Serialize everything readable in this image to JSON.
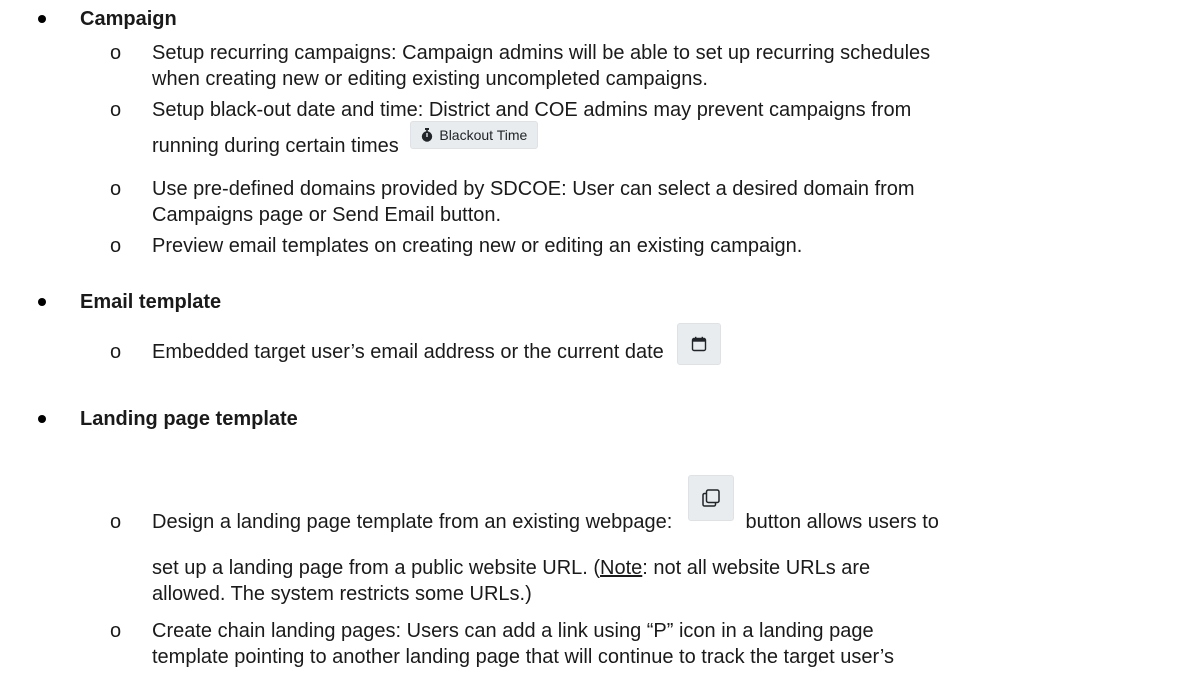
{
  "sections": {
    "campaign": {
      "heading": "Campaign",
      "items": [
        {
          "bullet": "o",
          "line1": "Setup recurring campaigns: Campaign admins will be able to set up recurring schedules",
          "line2": "when creating new or editing existing uncompleted campaigns."
        },
        {
          "bullet": "o",
          "line1": "Setup black-out date and time: District and COE admins may prevent campaigns from",
          "line2": "running during certain times",
          "button_label": "Blackout Time",
          "button_icon": "stopwatch-icon"
        },
        {
          "bullet": "o",
          "line1": "Use pre-defined domains provided by SDCOE: User can select a desired domain from",
          "line2": "Campaigns page or Send Email button."
        },
        {
          "bullet": "o",
          "line1": "Preview email templates on creating new or editing an existing campaign."
        }
      ]
    },
    "email_template": {
      "heading": "Email template",
      "items": [
        {
          "bullet": "o",
          "line1": "Embedded target user’s email address or the current date",
          "button_icon": "calendar-icon"
        }
      ]
    },
    "landing_page_template": {
      "heading": "Landing page template",
      "items": [
        {
          "bullet": "o",
          "line1_a": "Design a landing page template from an existing webpage:",
          "line1_b": "button allows users to",
          "button_icon": "copy-icon",
          "line2_a": "set up a landing page from a public website URL.  (",
          "note_label": "Note",
          "line2_b": ": not all website URLs are",
          "line3": "allowed.  The system restricts some URLs.)"
        },
        {
          "bullet": "o",
          "line1": "Create chain landing pages: Users can add a link using “P” icon in a landing page",
          "line2": "template pointing to another landing page that will continue to track the target user’s"
        }
      ]
    }
  }
}
